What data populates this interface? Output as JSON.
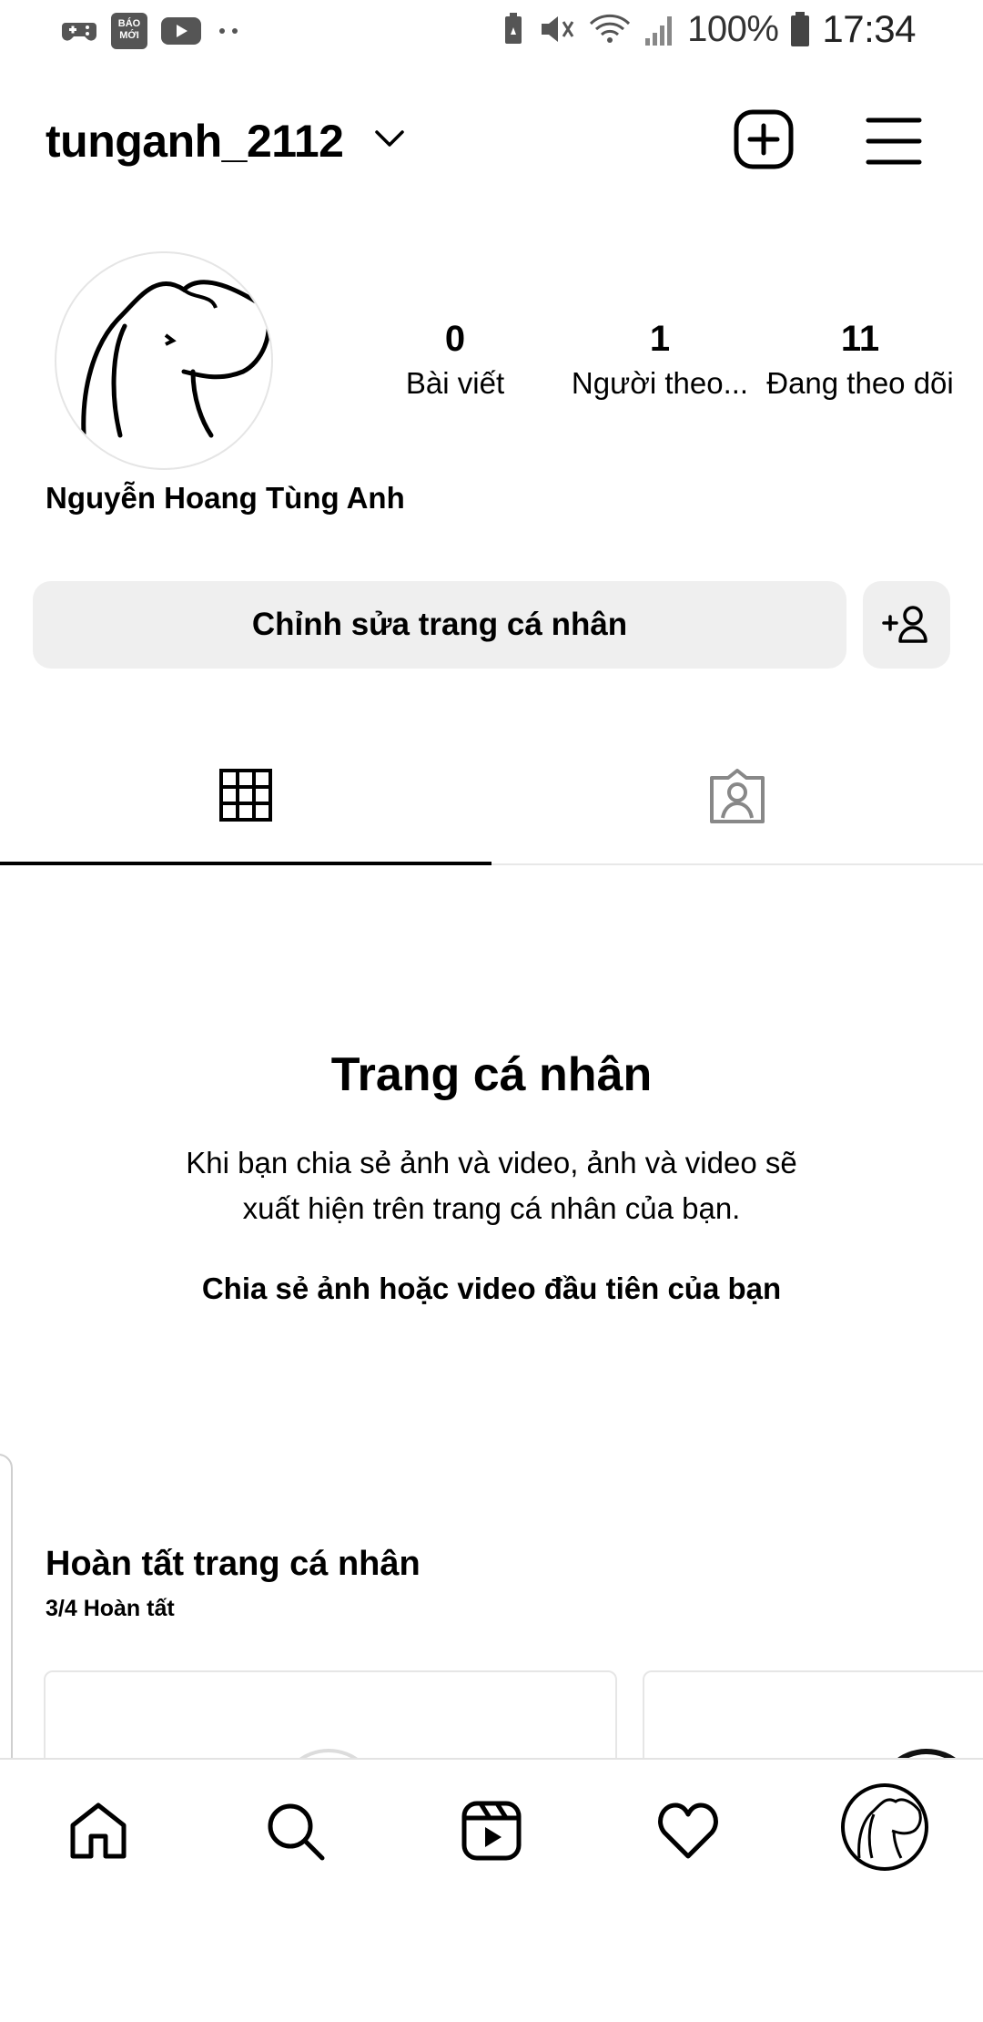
{
  "status_bar": {
    "app_tile_text": "BÁO MỚI",
    "battery": "100%",
    "time": "17:34"
  },
  "header": {
    "username": "tunganh_2112"
  },
  "profile": {
    "full_name": "Nguyễn Hoang Tùng Anh",
    "stats": [
      {
        "value": "0",
        "label": "Bài viết"
      },
      {
        "value": "1",
        "label": "Người theo..."
      },
      {
        "value": "11",
        "label": "Đang theo dõi"
      }
    ],
    "edit_button": "Chỉnh sửa trang cá nhân"
  },
  "tabs": [
    {
      "icon": "grid-icon",
      "active": true
    },
    {
      "icon": "tagged-person-icon",
      "active": false
    }
  ],
  "empty_state": {
    "title": "Trang cá nhân",
    "description": "Khi bạn chia sẻ ảnh và video, ảnh và video sẽ xuất hiện trên trang cá nhân của bạn.",
    "link": "Chia sẻ ảnh hoặc video đầu tiên của bạn"
  },
  "complete_profile": {
    "title": "Hoàn tất trang cá nhân",
    "progress": "3/4 Hoàn tất"
  },
  "bottom_nav": [
    {
      "icon": "home-icon"
    },
    {
      "icon": "search-icon"
    },
    {
      "icon": "reels-icon"
    },
    {
      "icon": "heart-icon"
    },
    {
      "icon": "profile-avatar"
    }
  ],
  "colors": {
    "button_bg": "#efefef",
    "text": "#000000",
    "divider": "#e8e8e8"
  }
}
